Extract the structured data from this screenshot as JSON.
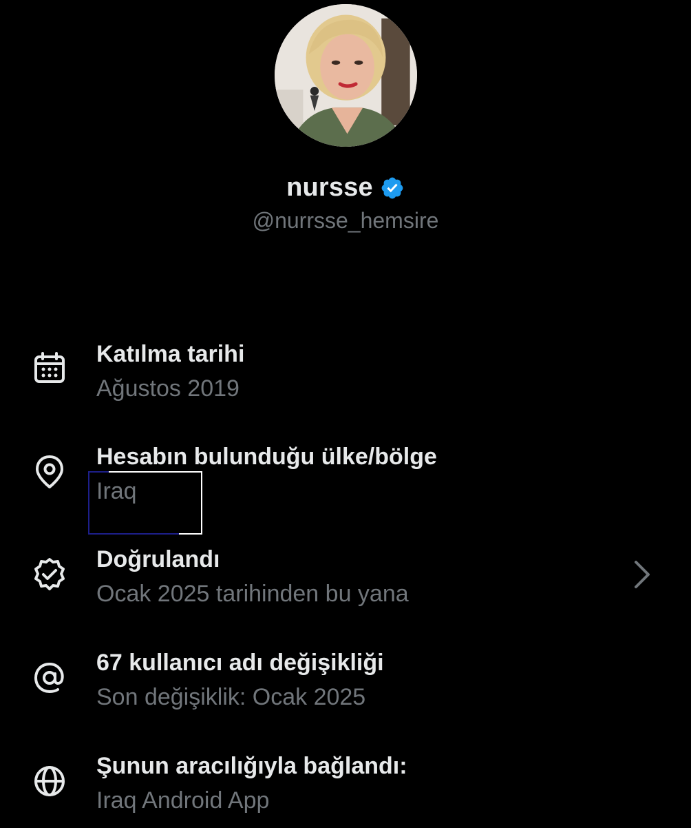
{
  "profile": {
    "display_name": "nursse",
    "handle": "@nurrsse_hemsire",
    "verified_badge_color": "#1d9bf0"
  },
  "about": {
    "rows": [
      {
        "icon": "calendar-icon",
        "title": "Katılma tarihi",
        "subtitle": "Ağustos 2019"
      },
      {
        "icon": "location-pin-icon",
        "title": "Hesabın bulunduğu ülke/bölge",
        "subtitle": "Iraq"
      },
      {
        "icon": "verified-check-icon",
        "title": "Doğrulandı",
        "subtitle": "Ocak 2025 tarihinden bu yana"
      },
      {
        "icon": "at-sign-icon",
        "title": "67 kullanıcı adı değişikliği",
        "subtitle": "Son değişiklik: Ocak 2025"
      },
      {
        "icon": "globe-icon",
        "title": "Şunun aracılığıyla bağlandı:",
        "subtitle": "Iraq Android App"
      }
    ]
  },
  "colors": {
    "background": "#000000",
    "primary_text": "#e7e9ea",
    "secondary_text": "#71767b",
    "highlight_box": "#ffffff"
  }
}
